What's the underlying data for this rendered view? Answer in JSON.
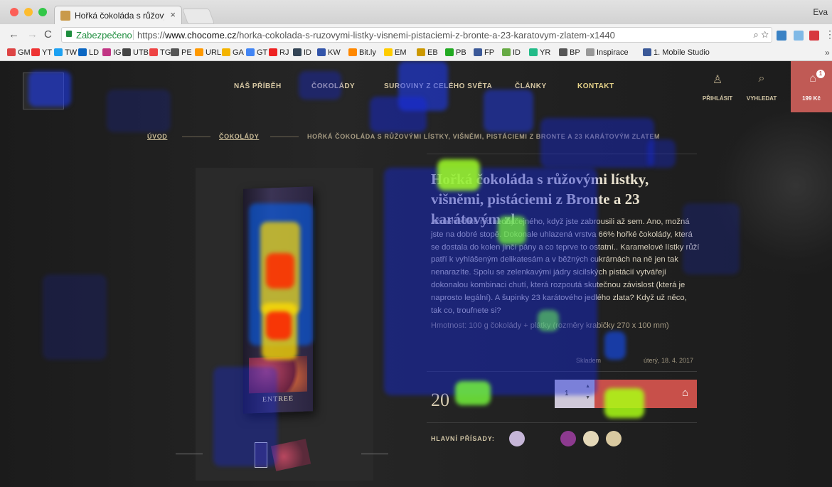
{
  "browser": {
    "tab_title": "Hořká čokoláda s růžovými líst",
    "profile": "Eva",
    "secure_label": "Zabezpečeno",
    "url_prefix": "https://",
    "url_host": "www.chocome.cz",
    "url_path": "/horka-cokolada-s-ruzovymi-listky-visnemi-pistaciemi-z-bronte-a-23-karatovym-zlatem-x1440",
    "bookmarks": [
      "GM",
      "YT",
      "TW",
      "LD",
      "IG",
      "UTB",
      "TG",
      "PE",
      "URL",
      "GA",
      "GT",
      "RJ",
      "ID",
      "KW",
      "Bit.ly",
      "EM",
      "EB",
      "PB",
      "FP",
      "ID",
      "YR",
      "BP",
      "Inspirace",
      "1. Mobile Studio"
    ],
    "bookmark_more": "»"
  },
  "site": {
    "nav": [
      "NÁŠ PŘÍBĚH",
      "ČOKOLÁDY",
      "SUROVINY Z CELÉHO SVĚTA",
      "ČLÁNKY",
      "KONTAKT"
    ],
    "login_label": "PŘIHLÁSIT",
    "search_label": "VYHLEDAT",
    "cart_label": "199 Kč",
    "cart_count": "1"
  },
  "breadcrumb": {
    "home": "ÚVOD",
    "category": "ČOKOLÁDY",
    "current": "HOŘKÁ ČOKOLÁDA S RŮŽOVÝMI LÍSTKY, VIŠNĚMI, PISTÁCIEMI Z BRONTE A 23 KARÁTOVÝM ZLATEM"
  },
  "product": {
    "box_brand": "ENTREE",
    "title": "Hořká čokoláda s růžovými lístky, višněmi, pistáciemi z Bronte a 23 karátovým zl",
    "description": "Ač nehledáte nic neobyčejného, když jste zabrousili až sem. Ano, možná jste na dobré stopě. Dokonale uhlazená vrstva 66% hořké čokolády, která se dostala do kolen jinčí pány a co teprve to ostatní.. Karamelové lístky růží patří k vyhlášeným delikatesám a v běžných cukrárnách na ně jen tak nenarazíte. Spolu se zelenkavými jádry sicilských pistácií vytvářejí dokonalou kombinaci chutí, která rozpoutá skutečnou závislost (která je naprosto legální). A šupinky 23 karátového jedlého zlata? Když už něco, tak co, troufnete si?",
    "weight": "Hmotnost: 100 g čokolády + plátky (rozměry krabičky 270 x 100 mm)",
    "stock": "Skladem",
    "delivery": "úterý, 18. 4. 2017",
    "price": "20",
    "quantity": "1",
    "ingredients_label": "HLAVNÍ PŘÍSADY:"
  }
}
